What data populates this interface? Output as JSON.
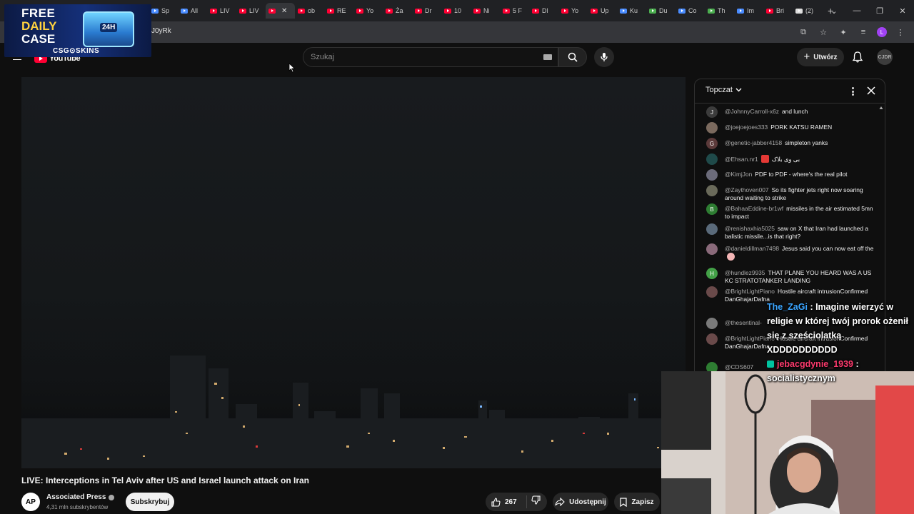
{
  "browser": {
    "tabs": [
      {
        "label": "Sp",
        "icon": "page-icon"
      },
      {
        "label": "All",
        "icon": "page-icon"
      },
      {
        "label": "LIV",
        "icon": "youtube-icon"
      },
      {
        "label": "LIV",
        "icon": "youtube-icon"
      },
      {
        "label": "",
        "icon": "youtube-icon",
        "active": true
      },
      {
        "label": "ob",
        "icon": "youtube-icon"
      },
      {
        "label": "RE",
        "icon": "youtube-icon"
      },
      {
        "label": "Yo",
        "icon": "youtube-icon"
      },
      {
        "label": "Ża",
        "icon": "youtube-icon"
      },
      {
        "label": "Dr",
        "icon": "youtube-icon"
      },
      {
        "label": "10",
        "icon": "youtube-icon"
      },
      {
        "label": "Ni",
        "icon": "youtube-icon"
      },
      {
        "label": "5 F",
        "icon": "youtube-icon"
      },
      {
        "label": "Dl",
        "icon": "youtube-icon"
      },
      {
        "label": "Yo",
        "icon": "youtube-icon"
      },
      {
        "label": "Up",
        "icon": "youtube-icon"
      },
      {
        "label": "Ku",
        "icon": "page-icon"
      },
      {
        "label": "Du",
        "icon": "maps-icon"
      },
      {
        "label": "Co",
        "icon": "page-icon"
      },
      {
        "label": "Th",
        "icon": "maps-icon"
      },
      {
        "label": "Im",
        "icon": "page-icon"
      },
      {
        "label": "Bri",
        "icon": "youtube-icon"
      },
      {
        "label": "(2)",
        "icon": "x-icon"
      }
    ],
    "url": "J0yRk",
    "profile_initial": "L"
  },
  "ad": {
    "line1": "FREE",
    "line2": "DAILY",
    "line3": "CASE",
    "badge": "24H",
    "brand": "CSG⊙SKINS"
  },
  "youtube": {
    "logo_text": "YouTube",
    "search_placeholder": "Szukaj",
    "create_label": "Utwórz",
    "avatar_text": "CJDR"
  },
  "video": {
    "title": "LIVE: Interceptions in Tel Aviv after US and Israel launch attack on Iran",
    "channel_initials": "AP",
    "channel_name": "Associated Press",
    "subscribers": "4,31 mln subskrybentów",
    "subscribe_label": "Subskrybuj",
    "likes": "267",
    "share_label": "Udostępnij",
    "save_label": "Zapisz"
  },
  "chat": {
    "title": "Topczat",
    "messages": [
      {
        "avatar": "J",
        "avatar_color": "#3c3c3c",
        "user": "@JohnnyCarroll-x6z",
        "text": "and lunch"
      },
      {
        "avatar": "",
        "avatar_color": "#7b6a5e",
        "user": "@joejoejoes333",
        "text": "PORK KATSU RAMEN"
      },
      {
        "avatar": "G",
        "avatar_color": "#5b3a3a",
        "user": "@genetic-jabber4158",
        "text": "simpleton yanks"
      },
      {
        "avatar": "",
        "avatar_color": "#1f4a4a",
        "user": "@Ehsan.nr1",
        "text": "بی وی بلاک"
      },
      {
        "avatar": "",
        "avatar_color": "#6b6b7a",
        "user": "@KimjJon",
        "text": "PDF to PDF - where's the real pilot"
      },
      {
        "avatar": "",
        "avatar_color": "#6a6a5a",
        "user": "@Zaythoven007",
        "text": "So its fighter jets right now soaring around waiting to strike"
      },
      {
        "avatar": "B",
        "avatar_color": "#2e7d32",
        "user": "@BahaaEddine-br1wf",
        "text": "missiles in the air estimated 5mn to impact"
      },
      {
        "avatar": "",
        "avatar_color": "#5a6a7a",
        "user": "@renishaxhia5025",
        "text": "saw on X that Iran had launched a balistic missile...is that right?"
      },
      {
        "avatar": "",
        "avatar_color": "#8a6a7a",
        "user": "@danieldillman7498",
        "text": "Jesus said you can now eat off the"
      },
      {
        "avatar": "H",
        "avatar_color": "#43a047",
        "user": "@hundlez9935",
        "text": "THAT PLANE YOU HEARD WAS A US KC STRATOTANKER LANDING"
      },
      {
        "avatar": "",
        "avatar_color": "#6a4a4a",
        "user": "@BrightLightPiano",
        "text": "Hostile aircraft intrusionConfirmed DanGhajarDafna"
      },
      {
        "avatar": "",
        "avatar_color": "#7a7a7a",
        "user": "@thesentinal-",
        "text": ""
      },
      {
        "avatar": "",
        "avatar_color": "#6a4a4a",
        "user": "@BrightLightPiano",
        "text": "Hostile aircraft intrusionConfirmed DanGhajarDafna"
      },
      {
        "avatar": "",
        "avatar_color": "#2e7d32",
        "user": "@CDS607",
        "text": ""
      }
    ]
  },
  "overlay_chat": [
    {
      "name": "The_ZaGi",
      "text": "Imagine wierzyć w religie w której twój prorok ożenił się z sześciolatką XDDDDDDDDDD"
    },
    {
      "name": "jebacgdynie_1939",
      "text": "socialistycznym"
    }
  ],
  "colors": {
    "yt_red": "#ff0033",
    "bg": "#0f0f0f",
    "overlay_blue": "#3ba5ff",
    "overlay_pink": "#ff3b6e"
  }
}
